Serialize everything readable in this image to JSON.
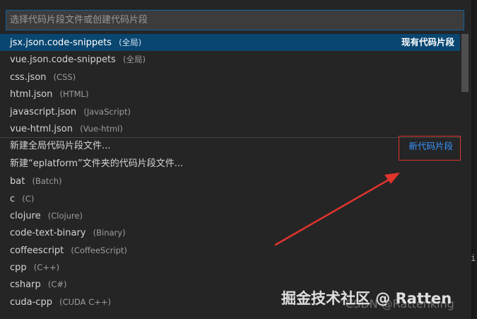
{
  "search": {
    "placeholder": "选择代码片段文件或创建代码片段"
  },
  "existing": {
    "group_label": "现有代码片段",
    "items": [
      {
        "label": "jsx.json.code-snippets",
        "desc": "(全局)"
      },
      {
        "label": "vue.json.code-snippets",
        "desc": "(全局)"
      },
      {
        "label": "css.json",
        "desc": "(CSS)"
      },
      {
        "label": "html.json",
        "desc": "(HTML)"
      },
      {
        "label": "javascript.json",
        "desc": "(JavaScript)"
      },
      {
        "label": "vue-html.json",
        "desc": "(Vue-html)"
      }
    ]
  },
  "new": {
    "group_label": "新代码片段",
    "items": [
      {
        "label": "新建全局代码片段文件...",
        "desc": ""
      },
      {
        "label": "新建“eplatform”文件夹的代码片段文件...",
        "desc": ""
      },
      {
        "label": "bat",
        "desc": "(Batch)"
      },
      {
        "label": "c",
        "desc": "(C)"
      },
      {
        "label": "clojure",
        "desc": "(Clojure)"
      },
      {
        "label": "code-text-binary",
        "desc": "(Binary)"
      },
      {
        "label": "coffeescript",
        "desc": "(CoffeeScript)"
      },
      {
        "label": "cpp",
        "desc": "(C++)"
      },
      {
        "label": "csharp",
        "desc": "(C#)"
      },
      {
        "label": "cuda-cpp",
        "desc": "(CUDA C++)"
      }
    ]
  },
  "background": {
    "editor_char": "i"
  },
  "watermark": {
    "main": "掘金技术社区 @ Ratten",
    "sub": "CSDN @Rattenking"
  },
  "colors": {
    "selection": "#094771",
    "accent_blue": "#3794ff",
    "annotation_red": "#e0342c"
  }
}
